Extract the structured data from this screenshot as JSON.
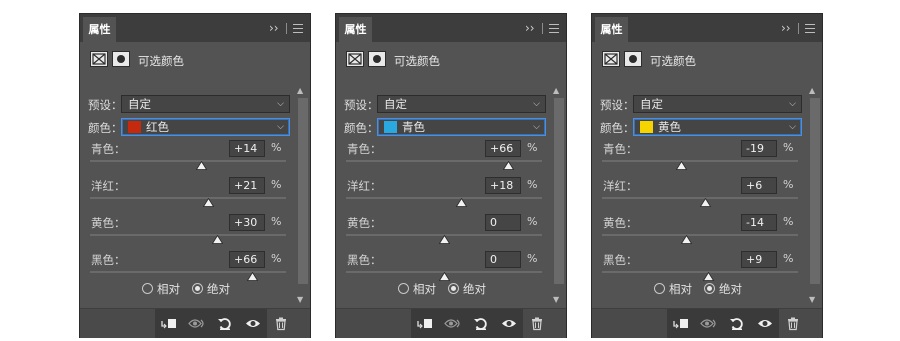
{
  "panels": [
    {
      "tab": "属性",
      "title": "可选颜色",
      "preset_label": "预设：",
      "preset_value": "自定",
      "color_label": "颜色：",
      "color_value": "红色",
      "swatch_color": "#c52a0e",
      "sliders": [
        {
          "label": "青色：",
          "value": "+14",
          "unit": "%",
          "level": 0.57
        },
        {
          "label": "洋红：",
          "value": "+21",
          "unit": "%",
          "level": 0.605
        },
        {
          "label": "黄色：",
          "value": "+30",
          "unit": "%",
          "level": 0.65
        },
        {
          "label": "黑色：",
          "value": "+66",
          "unit": "%",
          "level": 0.83
        }
      ],
      "radio_relative": "相对",
      "radio_absolute": "绝对",
      "selected_mode": "绝对"
    },
    {
      "tab": "属性",
      "title": "可选颜色",
      "preset_label": "预设：",
      "preset_value": "自定",
      "color_label": "颜色：",
      "color_value": "青色",
      "swatch_color": "#29a9e0",
      "sliders": [
        {
          "label": "青色：",
          "value": "+66",
          "unit": "%",
          "level": 0.83
        },
        {
          "label": "洋红：",
          "value": "+18",
          "unit": "%",
          "level": 0.59
        },
        {
          "label": "黄色：",
          "value": "0",
          "unit": "%",
          "level": 0.5
        },
        {
          "label": "黑色：",
          "value": "0",
          "unit": "%",
          "level": 0.5
        }
      ],
      "radio_relative": "相对",
      "radio_absolute": "绝对",
      "selected_mode": "绝对"
    },
    {
      "tab": "属性",
      "title": "可选颜色",
      "preset_label": "预设：",
      "preset_value": "自定",
      "color_label": "颜色：",
      "color_value": "黄色",
      "swatch_color": "#f5d400",
      "sliders": [
        {
          "label": "青色：",
          "value": "-19",
          "unit": "%",
          "level": 0.405
        },
        {
          "label": "洋红：",
          "value": "+6",
          "unit": "%",
          "level": 0.53
        },
        {
          "label": "黄色：",
          "value": "-14",
          "unit": "%",
          "level": 0.43
        },
        {
          "label": "黑色：",
          "value": "+9",
          "unit": "%",
          "level": 0.545
        }
      ],
      "radio_relative": "相对",
      "radio_absolute": "绝对",
      "selected_mode": "绝对"
    }
  ],
  "icons": {
    "collapse": "double-chevron-right-icon",
    "menu": "hamburger-menu-icon",
    "adjustment": "selective-color-adjustment-icon",
    "mask": "layer-mask-icon",
    "clip": "clip-to-layer-icon",
    "view_previous": "view-previous-state-icon",
    "reset": "reset-icon",
    "visibility": "eye-icon",
    "delete": "trash-icon"
  },
  "colors": {
    "panel_bg": "#535353",
    "titlebar_bg": "#3d3d3d",
    "focus_border": "#4a90e2"
  }
}
